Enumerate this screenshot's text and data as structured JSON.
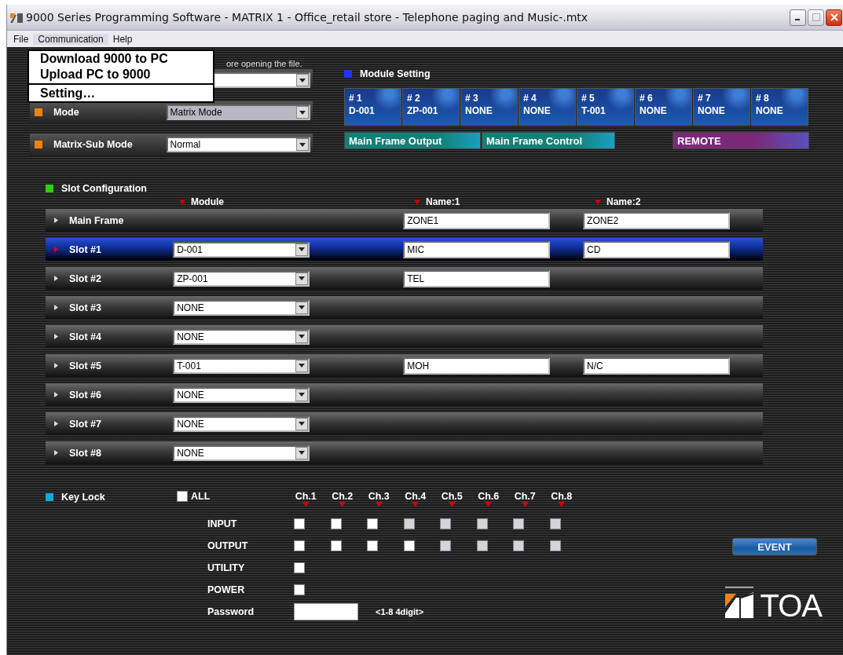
{
  "window": {
    "title": "9000 Series Programming Software - MATRIX 1 - Office_retail store - Telephone paging and Music-.mtx"
  },
  "menu_bar": [
    {
      "label": "File",
      "selected": false
    },
    {
      "label": "Communication",
      "selected": true
    },
    {
      "label": "Help",
      "selected": false
    }
  ],
  "open_menu": [
    {
      "label": "Download 9000 to PC",
      "separator_before": false
    },
    {
      "label": "Upload PC to 9000",
      "separator_before": false
    },
    {
      "label": "Setting…",
      "separator_before": true
    }
  ],
  "notice": "ore opening the file.",
  "settings": [
    {
      "label": "Mode",
      "value": "Matrix Mode",
      "disabled": true
    },
    {
      "label": "Matrix-Sub Mode",
      "value": "Normal",
      "disabled": false
    }
  ],
  "module_setting": {
    "title": "Module Setting",
    "modules": [
      {
        "number": "# 1",
        "name": "D-001"
      },
      {
        "number": "# 2",
        "name": "ZP-001"
      },
      {
        "number": "# 3",
        "name": "NONE"
      },
      {
        "number": "# 4",
        "name": "NONE"
      },
      {
        "number": "# 5",
        "name": "T-001"
      },
      {
        "number": "# 6",
        "name": "NONE"
      },
      {
        "number": "# 7",
        "name": "NONE"
      },
      {
        "number": "# 8",
        "name": "NONE"
      }
    ],
    "panels": [
      {
        "label": "Main Frame Output",
        "kind": "frame"
      },
      {
        "label": "Main Frame Control",
        "kind": "frame"
      },
      {
        "label": "REMOTE",
        "kind": "remote"
      }
    ]
  },
  "slot_configuration": {
    "title": "Slot Configuration",
    "columns": [
      "Module",
      "Name:1",
      "Name:2"
    ],
    "rows": [
      {
        "label": "Main Frame",
        "selected": false,
        "name_1": "ZONE1",
        "name_2": "ZONE2"
      },
      {
        "label": "Slot #1",
        "selected": true,
        "module": "D-001",
        "name_1": "MIC",
        "name_2": "CD"
      },
      {
        "label": "Slot #2",
        "selected": false,
        "module": "ZP-001",
        "name_1": "TEL"
      },
      {
        "label": "Slot #3",
        "selected": false,
        "module": "NONE"
      },
      {
        "label": "Slot #4",
        "selected": false,
        "module": "NONE"
      },
      {
        "label": "Slot #5",
        "selected": false,
        "module": "T-001",
        "name_1": "MOH",
        "name_2": "N/C"
      },
      {
        "label": "Slot #6",
        "selected": false,
        "module": "NONE"
      },
      {
        "label": "Slot #7",
        "selected": false,
        "module": "NONE"
      },
      {
        "label": "Slot #8",
        "selected": false,
        "module": "NONE"
      }
    ]
  },
  "key_lock": {
    "title": "Key Lock",
    "all": {
      "label": "ALL",
      "checked": false
    },
    "channels": [
      "Ch.1",
      "Ch.2",
      "Ch.3",
      "Ch.4",
      "Ch.5",
      "Ch.6",
      "Ch.7",
      "Ch.8"
    ],
    "rows": [
      {
        "label": "INPUT",
        "boxes": [
          {
            "checked": false,
            "disabled": false
          },
          {
            "checked": false,
            "disabled": false
          },
          {
            "checked": false,
            "disabled": false
          },
          {
            "checked": false,
            "disabled": true
          },
          {
            "checked": false,
            "disabled": true
          },
          {
            "checked": false,
            "disabled": true
          },
          {
            "checked": false,
            "disabled": true
          },
          {
            "checked": false,
            "disabled": true
          }
        ]
      },
      {
        "label": "OUTPUT",
        "boxes": [
          {
            "checked": false,
            "disabled": false
          },
          {
            "checked": false,
            "disabled": false
          },
          {
            "checked": false,
            "disabled": false
          },
          {
            "checked": false,
            "disabled": false
          },
          {
            "checked": false,
            "disabled": true
          },
          {
            "checked": false,
            "disabled": true
          },
          {
            "checked": false,
            "disabled": true
          },
          {
            "checked": false,
            "disabled": true
          }
        ]
      },
      {
        "label": "UTILITY",
        "boxes": [
          {
            "checked": false,
            "disabled": false
          }
        ]
      },
      {
        "label": "POWER",
        "boxes": [
          {
            "checked": false,
            "disabled": false
          }
        ]
      }
    ],
    "password": {
      "label": "Password",
      "hint": "<1-8 4digit>"
    }
  },
  "event_button": "EVENT",
  "logo": "TOA"
}
